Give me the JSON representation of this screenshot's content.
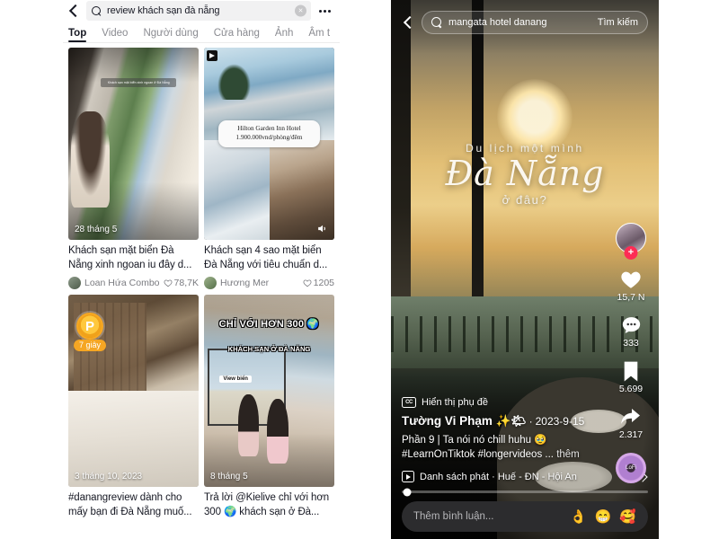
{
  "left_panel": {
    "search": {
      "query": "review khách sạn đà nẵng",
      "clear_label": "×",
      "icon": "search-icon",
      "more_icon": "more-options-icon",
      "back_icon": "back-chevron-icon"
    },
    "tabs": [
      {
        "label": "Top",
        "active": true
      },
      {
        "label": "Video",
        "active": false
      },
      {
        "label": "Người dùng",
        "active": false
      },
      {
        "label": "Cửa hàng",
        "active": false
      },
      {
        "label": "Ảnh",
        "active": false
      },
      {
        "label": "Âm t",
        "active": false
      }
    ],
    "results": [
      {
        "title": "Khách sạn mặt biển Đà Nẵng xinh ngoan iu đây d...",
        "author": "Loan Hứa Combo",
        "likes": "78,7K",
        "date_badge": "28 tháng 5",
        "overlay_caption": "Khách sạn mặt biển xinh ngoan ở Đà Nẵng"
      },
      {
        "title": "Khách sạn 4 sao mặt biển Đà Nẵng với tiêu chuẩn d...",
        "author": "Hương Mer",
        "likes": "1205",
        "date_badge": "",
        "price_title": "Hilton Garden Inn Hotel",
        "price_value": "1.900.000vnd/phòng/đêm",
        "volume_icon": "volume-on-icon"
      },
      {
        "title": "#danangreview dành cho mấy bạn đi Đà Nẵng muố...",
        "author": "",
        "likes": "",
        "date_badge": "3 tháng 10, 2023",
        "seconds_badge": "7 giây",
        "coin_badge": "P"
      },
      {
        "title": "Trả lời @Kielive chỉ với hơn 300 🌍 khách sạn ở Đà...",
        "author": "",
        "likes": "",
        "date_badge": "8 tháng 5",
        "overlay_caption_1": "CHỈ VỚI HƠN 300 🌍",
        "overlay_caption_2": "KHÁCH SẠN Ở ĐÀ NẴNG",
        "view_badge": "View biển"
      }
    ]
  },
  "right_panel": {
    "search": {
      "query": "mangata hotel danang",
      "button_label": "Tìm kiếm",
      "icon": "search-icon",
      "back_icon": "back-chevron-icon"
    },
    "video_overlay": {
      "line1": "Du lịch một mình",
      "line2": "Đà Nẵng",
      "line3": "ở đâu?"
    },
    "rail": {
      "avatar_icon": "profile-avatar",
      "follow_label": "+",
      "like": {
        "icon": "heart-icon",
        "count": "15,7 N"
      },
      "comment": {
        "icon": "comment-icon",
        "count": "333"
      },
      "bookmark": {
        "icon": "bookmark-icon",
        "count": "5.699"
      },
      "share": {
        "icon": "share-arrow-icon",
        "count": "2.317"
      },
      "music_disc": {
        "icon": "music-disc-icon",
        "label": "LoFi"
      }
    },
    "info": {
      "captions_icon": "closed-captions-icon",
      "captions_label": "Hiển thị phụ đề",
      "author": "Tường Vi Phạm ✨🌤",
      "separator": "·",
      "date": "2023-9-15",
      "description": "Phần 9 | Ta nói nó chill huhu 🥹 #LearnOnTiktok #longervideos ...",
      "more_label": "thêm",
      "playlist_icon": "playlist-icon",
      "playlist_label": "Danh sách phát · Huế - ĐN - Hội An",
      "playlist_chevron": "chevron-right-icon"
    },
    "comment_bar": {
      "placeholder": "Thêm bình luận...",
      "emoji": [
        "👌",
        "😁",
        "🥰"
      ]
    }
  }
}
